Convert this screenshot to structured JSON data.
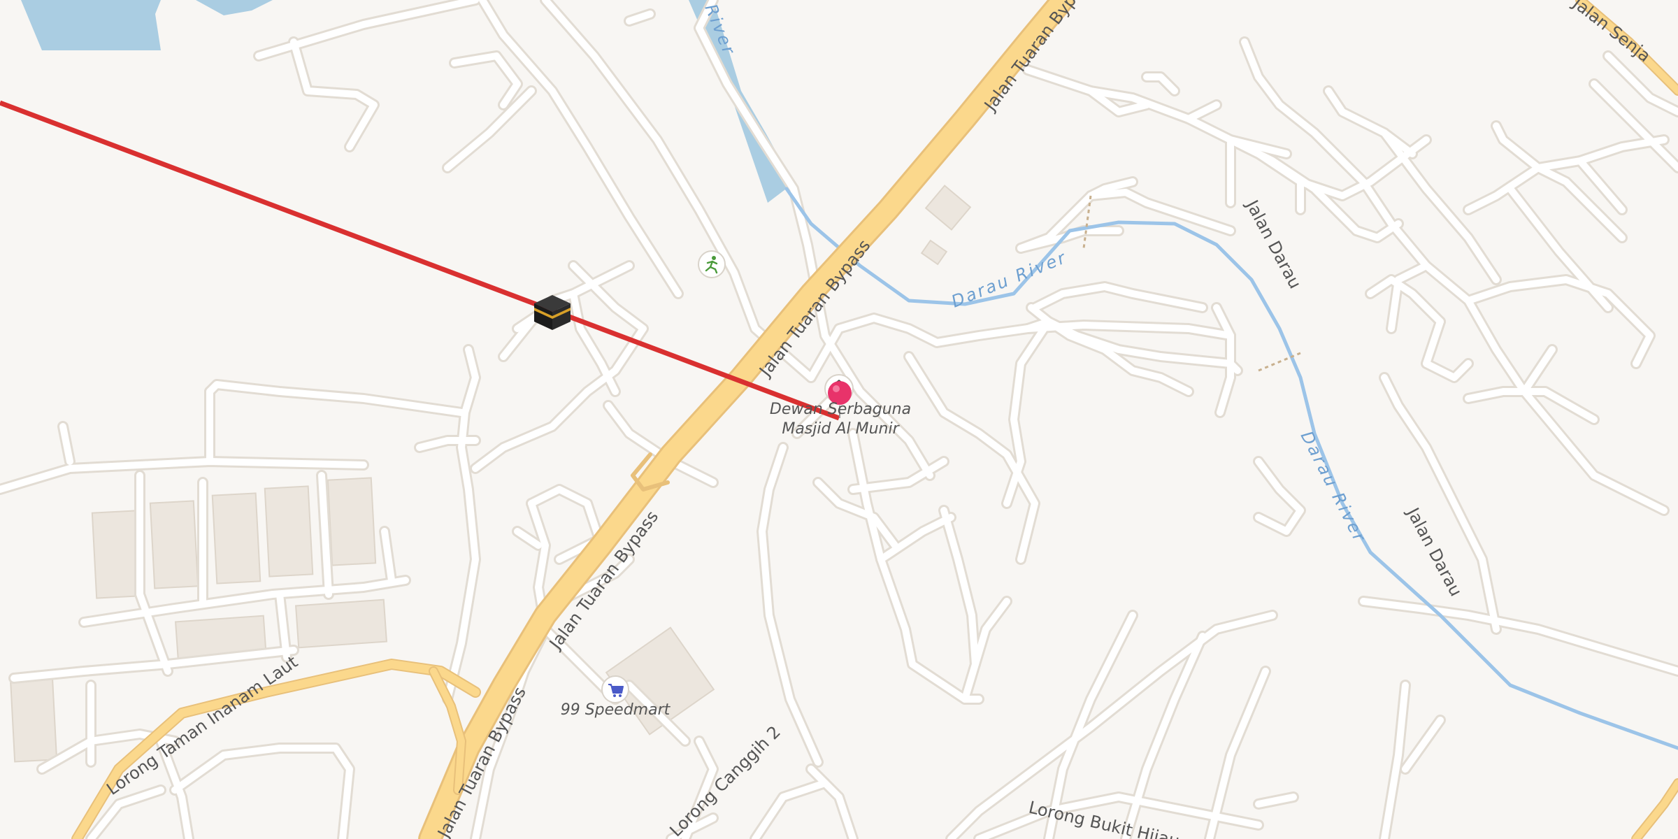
{
  "map": {
    "colors": {
      "land": "#f8f6f3",
      "water": "#aacde2",
      "river_line": "#9cc4e8",
      "river_label": "#6d9fd0",
      "road": "#ffffff",
      "road_casing": "#e2dcd3",
      "highway": "#fbd88c",
      "highway_casing": "#e8c07a",
      "building": "#ece6de",
      "qibla_line": "#d93030",
      "pin": "#e8336a"
    },
    "road_labels": {
      "bypass_1": "Jalan Tuaran Bypass",
      "bypass_2": "Jalan Tuaran Bypass",
      "bypass_3": "Jalan Tuaran Bypass",
      "bypass_4": "Jalan Tuaran Bypass",
      "darau_1": "Jalan Darau",
      "darau_2": "Jalan Darau",
      "inanam": "Lorong Taman Inanam Laut",
      "canggih": "Lorong Canggih 2",
      "bukit_hijau": "Lorong Bukit Hijau",
      "senja": "Jalan Senja"
    },
    "river_labels": {
      "river_top": "River",
      "darau_1": "Darau River",
      "darau_2": "Darau River"
    },
    "poi": {
      "mosque_name": "Dewan Serbaguna Masjid Al Munir",
      "mosque_line1": "Dewan Serbaguna",
      "mosque_line2": "Masjid Al Munir",
      "shop": "99 Speedmart"
    },
    "markers": {
      "qibla_icon": "kaaba-icon",
      "pin_icon": "location-pin-icon",
      "poi_icon": "mosque-icon",
      "shop_icon": "shopping-cart-icon",
      "sport_icon": "running-person-icon"
    }
  }
}
